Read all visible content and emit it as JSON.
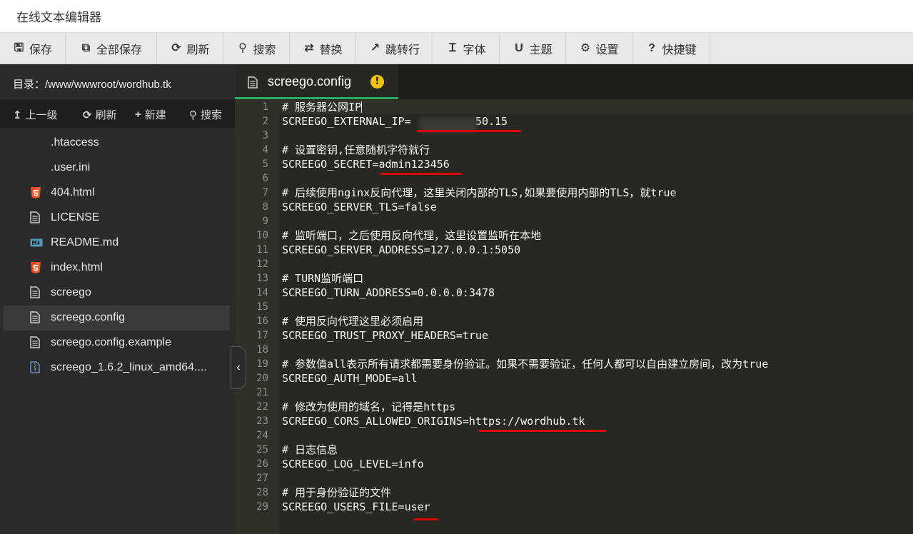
{
  "title": "在线文本编辑器",
  "toolbar": [
    {
      "name": "save",
      "icon": "floppy-icon",
      "glyph": "🖫",
      "label": "保存"
    },
    {
      "name": "save-all",
      "icon": "copy-icon",
      "glyph": "⧉",
      "label": "全部保存"
    },
    {
      "name": "refresh",
      "icon": "refresh-icon",
      "glyph": "⟳",
      "label": "刷新"
    },
    {
      "name": "search",
      "icon": "search-icon",
      "glyph": "⚲",
      "label": "搜索"
    },
    {
      "name": "replace",
      "icon": "replace-icon",
      "glyph": "⇄",
      "label": "替换"
    },
    {
      "name": "goto-line",
      "icon": "goto-icon",
      "glyph": "↗",
      "label": "跳转行"
    },
    {
      "name": "font",
      "icon": "font-icon",
      "glyph": "Ɪ",
      "label": "字体"
    },
    {
      "name": "theme",
      "icon": "theme-icon",
      "glyph": "U",
      "label": "主题"
    },
    {
      "name": "settings",
      "icon": "gear-icon",
      "glyph": "⚙",
      "label": "设置"
    },
    {
      "name": "shortcuts",
      "icon": "help-icon",
      "glyph": "?",
      "label": "快捷键"
    }
  ],
  "sidebar": {
    "directory": "目录：/www/wwwroot/wordhub.tk",
    "actions": [
      {
        "name": "up-level",
        "icon": "arrow-up-icon",
        "glyph": "↥",
        "label": "上一级"
      },
      {
        "name": "refresh",
        "icon": "refresh-icon",
        "glyph": "⟳",
        "label": "刷新"
      },
      {
        "name": "new",
        "icon": "plus-icon",
        "glyph": "+",
        "label": "新建"
      },
      {
        "name": "search",
        "icon": "search-icon",
        "glyph": "⚲",
        "label": "搜索"
      }
    ],
    "files": [
      {
        "name": ".htaccess",
        "icon": "none"
      },
      {
        "name": ".user.ini",
        "icon": "none"
      },
      {
        "name": "404.html",
        "icon": "html5-icon"
      },
      {
        "name": "LICENSE",
        "icon": "document-icon"
      },
      {
        "name": "README.md",
        "icon": "markdown-icon"
      },
      {
        "name": "index.html",
        "icon": "html5-icon"
      },
      {
        "name": "screego",
        "icon": "document-icon"
      },
      {
        "name": "screego.config",
        "icon": "document-icon",
        "active": true
      },
      {
        "name": "screego.config.example",
        "icon": "document-icon"
      },
      {
        "name": "screego_1.6.2_linux_amd64....",
        "icon": "archive-icon"
      }
    ],
    "collapse_glyph": "‹"
  },
  "editor": {
    "tab": {
      "filename": "screego.config",
      "status": "!"
    },
    "lines": [
      "# 服务器公网IP",
      "SCREEGO_EXTERNAL_IP=          50.15",
      "",
      "# 设置密钥,任意随机字符就行",
      "SCREEGO_SECRET=admin123456",
      "",
      "# 后续使用nginx反向代理，这里关闭内部的TLS,如果要使用内部的TLS，就true",
      "SCREEGO_SERVER_TLS=false",
      "",
      "# 监听端口，之后使用反向代理，这里设置监听在本地",
      "SCREEGO_SERVER_ADDRESS=127.0.0.1:5050",
      "",
      "# TURN监听端口",
      "SCREEGO_TURN_ADDRESS=0.0.0.0:3478",
      "",
      "# 使用反向代理这里必须启用",
      "SCREEGO_TRUST_PROXY_HEADERS=true",
      "",
      "# 参数值all表示所有请求都需要身份验证。如果不需要验证，任何人都可以自由建立房间，改为true",
      "SCREEGO_AUTH_MODE=all",
      "",
      "# 修改为使用的域名，记得是https",
      "SCREEGO_CORS_ALLOWED_ORIGINS=https://wordhub.tk",
      "",
      "# 日志信息",
      "SCREEGO_LOG_LEVEL=info",
      "",
      "# 用于身份验证的文件",
      "SCREEGO_USERS_FILE=user"
    ]
  },
  "colors": {
    "accent": "#27ae60",
    "annotation": "#e00000",
    "warning": "#f4c20d"
  }
}
